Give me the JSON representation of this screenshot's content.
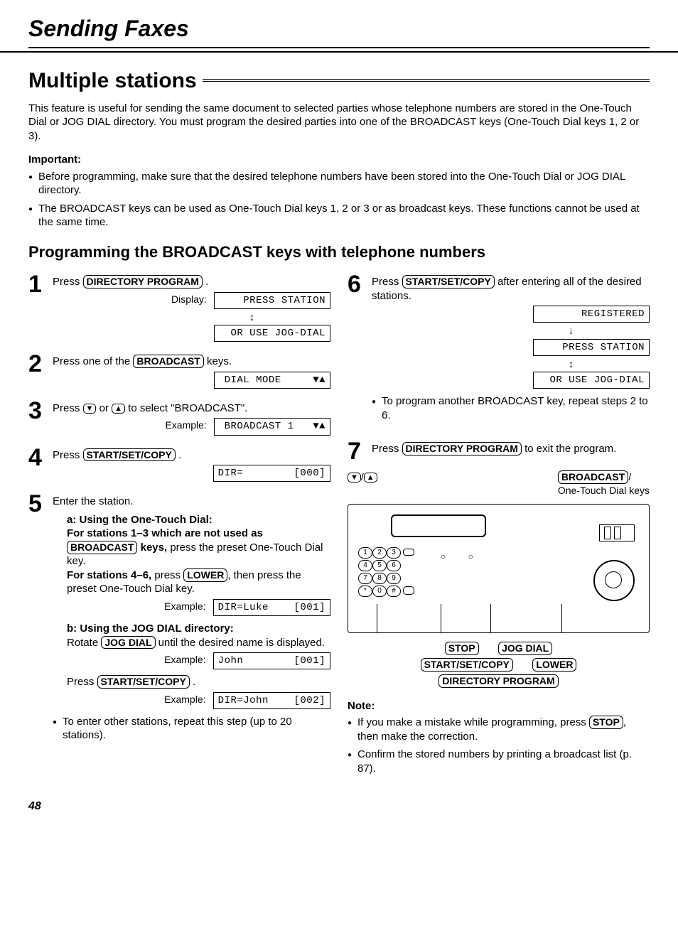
{
  "header": {
    "title": "Sending Faxes"
  },
  "section": {
    "title": "Multiple stations"
  },
  "intro": "This feature is useful for sending the same document to selected parties whose telephone numbers are stored in the One-Touch Dial or JOG DIAL directory. You must program the desired parties into one of the BROADCAST keys (One-Touch Dial keys 1, 2 or 3).",
  "important": {
    "label": "Important:",
    "items": [
      "Before programming, make sure that the desired telephone numbers have been stored into the One-Touch Dial or JOG DIAL directory.",
      "The BROADCAST keys can be used as One-Touch Dial keys 1, 2 or 3 or as broadcast keys. These functions cannot be used at the same time."
    ]
  },
  "subheading": "Programming the BROADCAST keys with telephone numbers",
  "keys": {
    "directory_program": "DIRECTORY PROGRAM",
    "broadcast": "BROADCAST",
    "start_set_copy": "START/SET/COPY",
    "lower": "LOWER",
    "jog_dial": "JOG DIAL",
    "stop": "STOP"
  },
  "labels": {
    "display": "Display:",
    "example": "Example:",
    "press": "Press ",
    "after_entering": " after entering all of the desired stations.",
    "to_exit": " to exit the program.",
    "press_one_of": "Press one of the ",
    "keys_suffix": " keys.",
    "or": " or ",
    "to_select": " to select \"BROADCAST\".",
    "enter_station": "Enter the station.",
    "one_touch_label": "One-Touch Dial keys"
  },
  "lcd": {
    "press_station": "PRESS STATION",
    "or_use_jog": "OR USE JOG-DIAL",
    "dial_mode": "DIAL MODE     ▼▲",
    "broadcast1": "BROADCAST 1   ▼▲",
    "dir000": "DIR=        [000]",
    "dir_luke": "DIR=Luke    [001]",
    "john": "John        [001]",
    "dir_john": "DIR=John    [002]",
    "registered": "REGISTERED"
  },
  "step5": {
    "a_label": "a: Using the One-Touch Dial:",
    "a_line1a": "For stations 1–3 which are not used as ",
    "a_line1b": " keys,",
    "a_line1c": " press the preset One-Touch Dial key.",
    "a_line2a": "For stations 4–6,",
    "a_line2b": " press ",
    "a_line2c": ", then press the preset One-Touch Dial key.",
    "b_label": "b: Using the JOG DIAL directory:",
    "b_line1a": "Rotate ",
    "b_line1b": " until the desired name is displayed.",
    "press_ssc": "Press ",
    "footer": "To enter other stations, repeat this step (up to 20 stations)."
  },
  "step6_note": "To program another BROADCAST key, repeat steps 2 to 6.",
  "note": {
    "label": "Note:",
    "items": [
      "If you make a mistake while programming, press (STOP), then make the correction.",
      "Confirm the stored numbers by printing a broadcast list (p. 87)."
    ]
  },
  "note_item1_pre": "If you make a mistake while programming, press ",
  "note_item1_post": ", then make the correction.",
  "note_item2": "Confirm the stored numbers by printing a broadcast list (p. 87).",
  "page_number": "48"
}
